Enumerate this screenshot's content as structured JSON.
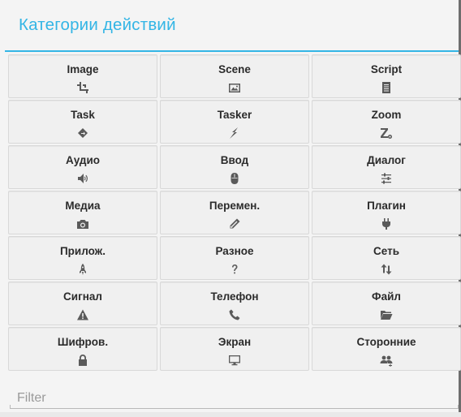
{
  "dialog": {
    "title": "Категории действий",
    "accent_color": "#33b5e5"
  },
  "categories": [
    {
      "label": "Image",
      "icon": "crop-icon"
    },
    {
      "label": "Scene",
      "icon": "picture-icon"
    },
    {
      "label": "Script",
      "icon": "script-doc-icon"
    },
    {
      "label": "Task",
      "icon": "task-diamond-icon"
    },
    {
      "label": "Tasker",
      "icon": "lightning-icon"
    },
    {
      "label": "Zoom",
      "icon": "zoom-z-gear-icon"
    },
    {
      "label": "Аудио",
      "icon": "speaker-icon"
    },
    {
      "label": "Ввод",
      "icon": "mouse-icon"
    },
    {
      "label": "Диалог",
      "icon": "sliders-icon"
    },
    {
      "label": "Медиа",
      "icon": "camera-icon"
    },
    {
      "label": "Перемен.",
      "icon": "pencil-icon"
    },
    {
      "label": "Плагин",
      "icon": "plug-icon"
    },
    {
      "label": "Прилож.",
      "icon": "rocket-icon"
    },
    {
      "label": "Разное",
      "icon": "question-icon"
    },
    {
      "label": "Сеть",
      "icon": "up-down-arrows-icon"
    },
    {
      "label": "Сигнал",
      "icon": "warning-icon"
    },
    {
      "label": "Телефон",
      "icon": "phone-icon"
    },
    {
      "label": "Файл",
      "icon": "folder-open-icon"
    },
    {
      "label": "Шифров.",
      "icon": "lock-icon"
    },
    {
      "label": "Экран",
      "icon": "monitor-icon"
    },
    {
      "label": "Сторонние",
      "icon": "third-party-users-icon"
    }
  ],
  "filter": {
    "placeholder": "Filter",
    "value": ""
  }
}
